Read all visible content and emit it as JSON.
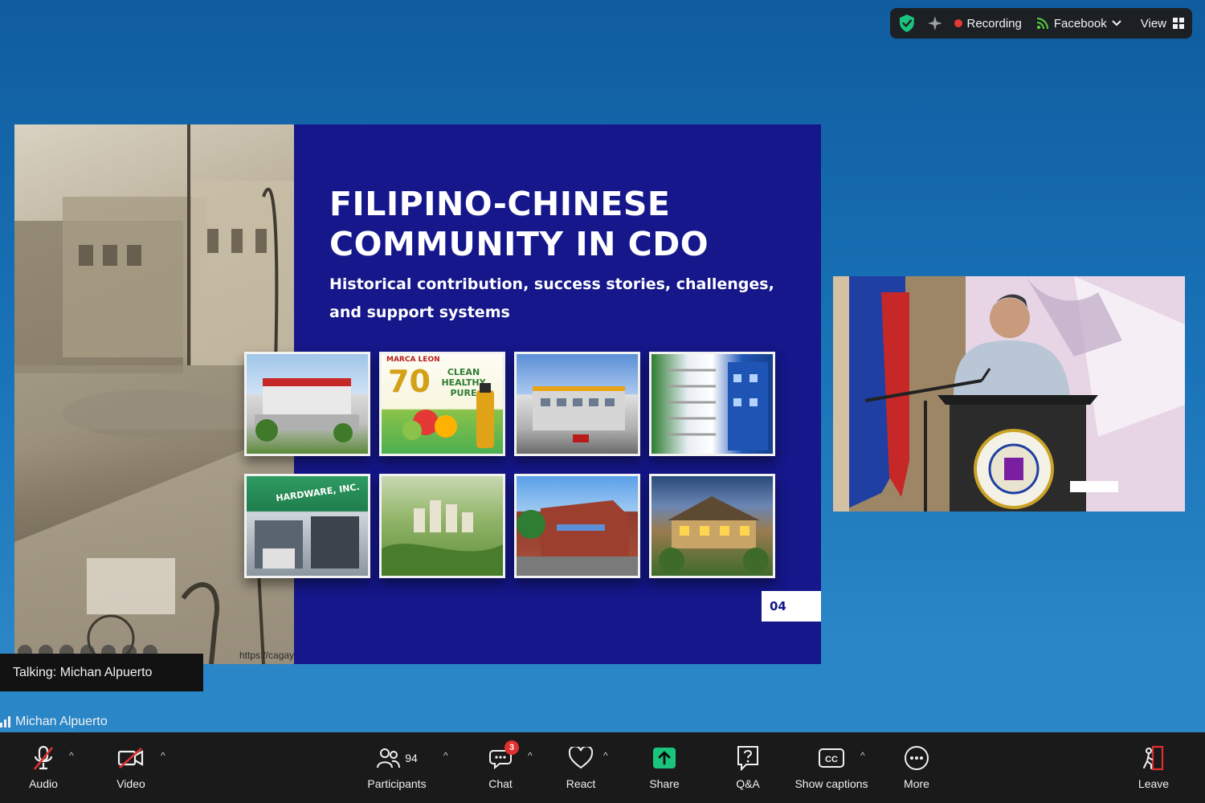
{
  "top_bar": {
    "recording_label": "Recording",
    "stream_label": "Facebook",
    "view_label": "View"
  },
  "slide": {
    "title": "FILIPINO-CHINESE\nCOMMUNITY IN CDO",
    "subtitle": "Historical contribution, success stories, challenges, and support systems",
    "page_number": "04",
    "photo_credit": "https://cagay",
    "thumb_texts": {
      "marca_leon": "MARCA LEON",
      "anniversary": "70",
      "tagline": "CLEAN HEALTHY PURE",
      "hardware_sign": "HARDWARE, INC."
    }
  },
  "talking": {
    "label": "Talking: Michan Alpuerto"
  },
  "self_view": {
    "name": "Michan Alpuerto"
  },
  "toolbar": {
    "audio": "Audio",
    "video": "Video",
    "participants": "Participants",
    "participant_count": "94",
    "chat": "Chat",
    "chat_badge": "3",
    "react": "React",
    "share": "Share",
    "qa": "Q&A",
    "captions": "Show captions",
    "more": "More",
    "leave": "Leave"
  },
  "colors": {
    "slide_background": "#15178a",
    "share_accent": "#1bc47d",
    "recording_dot": "#e53935",
    "muted_red": "#e02f2f",
    "shield_green": "#1bc47d",
    "stream_green": "#5ad13d"
  },
  "icons": {
    "security": "shield-check-icon",
    "ai": "sparkle-icon",
    "stream": "broadcast-icon",
    "view": "grid-icon",
    "audio": "mic-muted-icon",
    "video": "camera-muted-icon",
    "participants": "people-icon",
    "chat": "chat-bubble-icon",
    "react": "heart-icon",
    "share": "share-arrow-icon",
    "qa": "question-icon",
    "captions": "cc-icon",
    "more": "ellipsis-icon",
    "leave": "exit-door-icon"
  }
}
